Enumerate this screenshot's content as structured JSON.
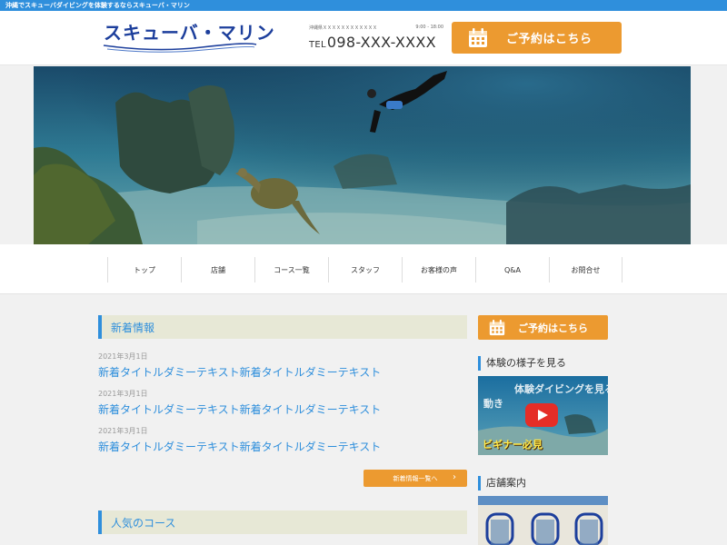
{
  "topbar": {
    "text": "沖縄でスキューバダイビングを体験するならスキューバ・マリン"
  },
  "header": {
    "logo_text": "スキューバ・マリン",
    "address": "沖縄県ＸＸＸＸＸＸＸＸＸＸＸＸ",
    "hours": "9:00 - 18:00",
    "tel_prefix": "TEL",
    "tel_number": "098-XXX-XXXX",
    "reserve_label": "ご予約はこちら"
  },
  "nav": {
    "items": [
      {
        "label": "トップ"
      },
      {
        "label": "店舗"
      },
      {
        "label": "コース一覧"
      },
      {
        "label": "スタッフ"
      },
      {
        "label": "お客様の声"
      },
      {
        "label": "Q&A"
      },
      {
        "label": "お問合せ"
      }
    ]
  },
  "main": {
    "news_heading": "新着情報",
    "news": [
      {
        "date": "2021年3月1日",
        "title": "新着タイトルダミーテキスト新着タイトルダミーテキスト"
      },
      {
        "date": "2021年3月1日",
        "title": "新着タイトルダミーテキスト新着タイトルダミーテキスト"
      },
      {
        "date": "2021年3月1日",
        "title": "新着タイトルダミーテキスト新着タイトルダミーテキスト"
      }
    ],
    "more_label": "新着情報一覧へ",
    "courses_heading": "人気のコース"
  },
  "sidebar": {
    "reserve_label": "ご予約はこちら",
    "video_heading": "体験の様子を見る",
    "video": {
      "line1": "体験ダイビングを見る",
      "line2": "動き",
      "line3": "ビギナー必見"
    },
    "shop_heading": "店舗案内"
  },
  "colors": {
    "accent_blue": "#2f8fdc",
    "orange": "#ec9a30",
    "section_bg": "#e7e8d6",
    "logo_blue": "#1d3f9c"
  },
  "icons": [
    "calendar-icon",
    "chevron-right-icon",
    "play-icon"
  ]
}
